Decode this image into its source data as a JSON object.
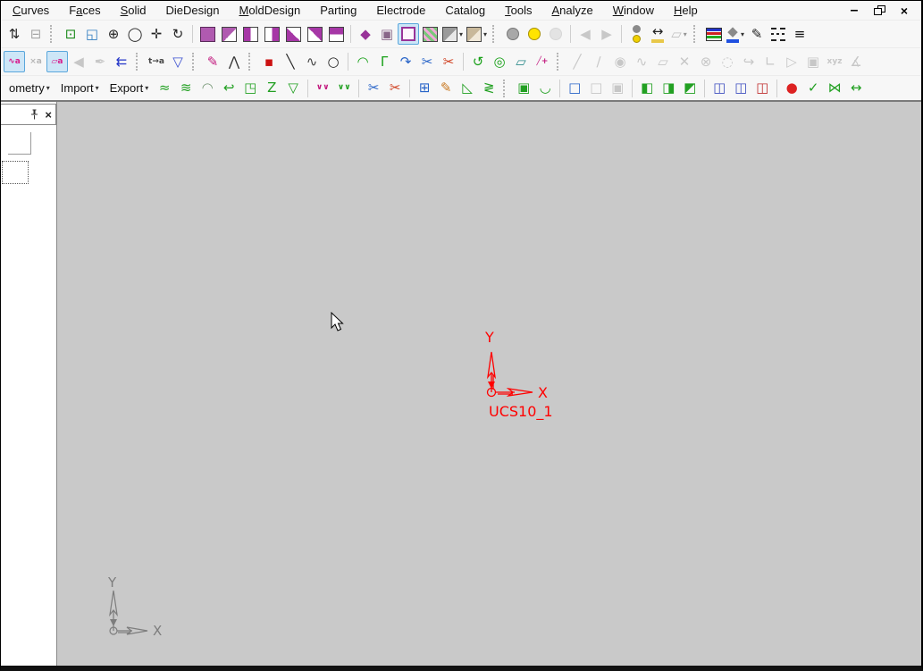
{
  "window_controls": {
    "minimize_glyph": "–",
    "close_glyph": "×"
  },
  "menubar": {
    "items": [
      {
        "label": "Curves",
        "u": 0
      },
      {
        "label": "Faces",
        "u": 1
      },
      {
        "label": "Solid",
        "u": 0
      },
      {
        "label": "DieDesign",
        "u": -1
      },
      {
        "label": "MoldDesign",
        "u": 0
      },
      {
        "label": "Parting",
        "u": -1
      },
      {
        "label": "Electrode",
        "u": -1
      },
      {
        "label": "Catalog",
        "u": -1
      },
      {
        "label": "Tools",
        "u": 0
      },
      {
        "label": "Analyze",
        "u": 0
      },
      {
        "label": "Window",
        "u": 0
      },
      {
        "label": "Help",
        "u": 0
      }
    ]
  },
  "toolbars": {
    "row2": [
      {
        "n": "rebuild-icon",
        "g": "⇅",
        "c": "#222222"
      },
      {
        "n": "delete-history-icon",
        "g": "⊟",
        "c": "#555555",
        "dis": 1
      },
      {
        "t": "grip"
      },
      {
        "n": "zoom-fit-icon",
        "g": "⊡",
        "c": "#1a8a1a"
      },
      {
        "n": "zoom-window-icon",
        "g": "◱",
        "c": "#2e7bbf"
      },
      {
        "n": "zoom-in-out-icon",
        "g": "⊕",
        "c": "#222222"
      },
      {
        "n": "magnifier-icon",
        "g": "◯",
        "c": "#222222"
      },
      {
        "n": "pan-icon",
        "g": "✛",
        "c": "#222222"
      },
      {
        "n": "rotate-view-icon",
        "g": "↻",
        "c": "#222222"
      },
      {
        "t": "sep"
      },
      {
        "n": "shaded-view-icon",
        "shape": "cube cube-solid"
      },
      {
        "n": "isometric-view-icon",
        "shape": "cube cube-iso"
      },
      {
        "n": "front-view-icon",
        "shape": "cube cube-front"
      },
      {
        "n": "back-view-icon",
        "shape": "cube cube-back"
      },
      {
        "n": "left-view-icon",
        "shape": "cube cube-left"
      },
      {
        "n": "right-view-icon",
        "shape": "cube cube-right"
      },
      {
        "n": "top-view-icon",
        "shape": "cube cube-top"
      },
      {
        "t": "sep"
      },
      {
        "n": "normal-to-icon",
        "g": "◆",
        "c": "#993399"
      },
      {
        "n": "named-view-icon",
        "g": "▣",
        "c": "#886688"
      },
      {
        "n": "wireframe-view-icon",
        "shape": "cube cube-wire",
        "sel": 1
      },
      {
        "n": "textured-view-icon",
        "shape": "cube cube-tex"
      },
      {
        "n": "display-style-dropdown",
        "shape": "cube cube-gray",
        "dd": 1
      },
      {
        "n": "view-options-dropdown",
        "shape": "cube cube-gray2",
        "dd": 1
      },
      {
        "t": "grip"
      },
      {
        "n": "light-off-icon",
        "shape": "bulb"
      },
      {
        "n": "light-on-icon",
        "shape": "bulb on"
      },
      {
        "n": "pick-light-icon",
        "shape": "bulb dim",
        "dis": 1
      },
      {
        "t": "sep"
      },
      {
        "n": "previous-view-icon",
        "g": "◀",
        "c": "#9a9a9a",
        "dis": 1
      },
      {
        "n": "next-view-icon",
        "g": "▶",
        "c": "#9a9a9a",
        "dis": 1
      },
      {
        "t": "sep"
      },
      {
        "n": "swap-display-icon",
        "shape": "dotswap"
      },
      {
        "n": "measure-icon",
        "g": "↔",
        "c": "#222222",
        "ub": "#e8c84a"
      },
      {
        "n": "dimension-dropdown",
        "g": "▱",
        "c": "#888888",
        "dis": 1,
        "dd": 1
      },
      {
        "t": "grip"
      },
      {
        "n": "layer-manager-icon",
        "shape": "layers"
      },
      {
        "n": "fill-color-dropdown",
        "g": "◆",
        "c": "#8a8a8a",
        "ub": "#2050e0",
        "dd": 1
      },
      {
        "n": "pen-color-icon",
        "g": "✎",
        "c": "#222222"
      },
      {
        "n": "line-style-icon",
        "shape": "dashes"
      },
      {
        "n": "line-weight-icon",
        "g": "≡",
        "c": "#111111"
      }
    ],
    "row3": [
      {
        "n": "curve-names-toggle",
        "g": "∿a",
        "c": "#d81b8c",
        "sel": 1,
        "sm": 1
      },
      {
        "n": "hide-names-icon",
        "g": "×a",
        "c": "#777777",
        "dis": 1,
        "sm": 1
      },
      {
        "n": "face-names-toggle",
        "g": "▱a",
        "c": "#d81b8c",
        "sel": 1,
        "sm": 1
      },
      {
        "n": "apply-color-icon",
        "g": "◀",
        "c": "#999999",
        "dis": 1
      },
      {
        "n": "signature-icon",
        "g": "✒",
        "c": "#999999",
        "dis": 1
      },
      {
        "n": "swap-list-icon",
        "g": "⇇",
        "c": "#2436c8"
      },
      {
        "t": "grip"
      },
      {
        "n": "rename-icon",
        "g": "t→a",
        "c": "#444444",
        "sm": 1
      },
      {
        "n": "selection-filter-icon",
        "g": "▽",
        "c": "#3a4fd0"
      },
      {
        "t": "grip"
      },
      {
        "n": "edit-sketch-icon",
        "g": "✎",
        "c": "#c2187e"
      },
      {
        "n": "lasso-select-icon",
        "g": "⋀",
        "c": "#333333"
      },
      {
        "t": "grip"
      },
      {
        "n": "point-icon",
        "g": "▪",
        "c": "#cc1111"
      },
      {
        "n": "line-icon",
        "g": "╲",
        "c": "#222222"
      },
      {
        "n": "spline-icon",
        "g": "∿",
        "c": "#444444"
      },
      {
        "n": "circle-icon",
        "g": "○",
        "c": "#222222"
      },
      {
        "t": "sep"
      },
      {
        "n": "fillet-curve-icon",
        "g": "◠",
        "c": "#18a018"
      },
      {
        "n": "corner-curve-icon",
        "g": "Γ",
        "c": "#18a018"
      },
      {
        "n": "extend-curve-icon",
        "g": "↷",
        "c": "#2864c8"
      },
      {
        "n": "trim-curve-icon",
        "g": "✂",
        "c": "#2864c8"
      },
      {
        "n": "split-curve-icon",
        "g": "✂",
        "c": "#d04020"
      },
      {
        "t": "sep"
      },
      {
        "n": "project-curve-icon",
        "g": "↺",
        "c": "#18a018"
      },
      {
        "n": "silhouette-curve-icon",
        "g": "◎",
        "c": "#18a018"
      },
      {
        "n": "flatten-curve-icon",
        "g": "▱",
        "c": "#2e8b8b"
      },
      {
        "n": "offset-curve-icon",
        "g": "╱+",
        "c": "#c2187e",
        "sm": 1
      },
      {
        "t": "grip"
      },
      {
        "n": "sketch-line-icon",
        "g": "╱",
        "c": "#999999",
        "dis": 1
      },
      {
        "n": "sketch-segment-icon",
        "g": "∕",
        "c": "#999999",
        "dis": 1
      },
      {
        "n": "sketch-circle-icon",
        "g": "◉",
        "c": "#999999",
        "dis": 1
      },
      {
        "n": "sketch-curve-icon",
        "g": "∿",
        "c": "#999999",
        "dis": 1
      },
      {
        "n": "sketch-plane-icon",
        "g": "▱",
        "c": "#999999",
        "dis": 1
      },
      {
        "n": "delete-entity-icon",
        "g": "✕",
        "c": "#999999",
        "dis": 1
      },
      {
        "n": "erase-entity-icon",
        "g": "⊗",
        "c": "#999999",
        "dis": 1
      },
      {
        "n": "select-chain-icon",
        "g": "◌",
        "c": "#999999",
        "dis": 1
      },
      {
        "n": "probe-point-icon",
        "g": "↪",
        "c": "#999999",
        "dis": 1
      },
      {
        "n": "axis-system-icon",
        "g": "∟",
        "c": "#999999",
        "dis": 1
      },
      {
        "n": "pointer-mode-icon",
        "g": "▷",
        "c": "#999999",
        "dis": 1
      },
      {
        "n": "grid-point-icon",
        "g": "▣",
        "c": "#999999",
        "dis": 1
      },
      {
        "n": "xyz-point-icon",
        "g": "xyz",
        "c": "#999999",
        "dis": 1,
        "sm": 1
      },
      {
        "n": "angle-point-icon",
        "g": "∡",
        "c": "#999999",
        "dis": 1
      }
    ],
    "row4": [
      {
        "n": "geometry-menu-button",
        "label": "ometry",
        "dd": 1
      },
      {
        "n": "import-menu-button",
        "label": "Import",
        "dd": 1
      },
      {
        "n": "export-menu-button",
        "label": "Export",
        "dd": 1
      },
      {
        "n": "surface-loft-icon",
        "g": "≈",
        "c": "#22a022"
      },
      {
        "n": "surface-sweep-icon",
        "g": "≋",
        "c": "#22a022"
      },
      {
        "n": "surface-dome-icon",
        "g": "◠",
        "c": "#7a9a7a"
      },
      {
        "n": "surface-flip-icon",
        "g": "↩",
        "c": "#22a022"
      },
      {
        "n": "surface-fold-icon",
        "g": "◳",
        "c": "#22a022"
      },
      {
        "n": "midplane-icon",
        "g": "Z",
        "c": "#22a022"
      },
      {
        "n": "surface-funnel-icon",
        "g": "▽",
        "c": "#22a022"
      },
      {
        "t": "sep"
      },
      {
        "n": "knit-surface-icon",
        "g": "∨∨",
        "c": "#c2187e",
        "sm": 1
      },
      {
        "n": "unknit-surface-icon",
        "g": "∨∨",
        "c": "#22a022",
        "sm": 1
      },
      {
        "t": "sep"
      },
      {
        "n": "trim-surface-icon",
        "g": "✂",
        "c": "#2864c8"
      },
      {
        "n": "untrim-surface-icon",
        "g": "✂",
        "c": "#d04020"
      },
      {
        "t": "sep"
      },
      {
        "n": "move-face-icon",
        "g": "⊞",
        "c": "#2864c8"
      },
      {
        "n": "edit-face-icon",
        "g": "✎",
        "c": "#c87820"
      },
      {
        "n": "flatten-surface-icon",
        "g": "◺",
        "c": "#22a022"
      },
      {
        "n": "replace-face-icon",
        "g": "≷",
        "c": "#22a022"
      },
      {
        "t": "grip"
      },
      {
        "n": "new-block-icon",
        "g": "▣",
        "c": "#22a022"
      },
      {
        "n": "new-cavity-icon",
        "g": "◡",
        "c": "#22a022"
      },
      {
        "t": "sep"
      },
      {
        "n": "open-box-icon",
        "g": "□",
        "c": "#2864c8"
      },
      {
        "n": "box-tool-icon",
        "g": "□",
        "c": "#999999",
        "dis": 1
      },
      {
        "n": "frame-box-icon",
        "g": "▣",
        "c": "#999999",
        "dis": 1
      },
      {
        "t": "sep"
      },
      {
        "n": "corner-solid-icon",
        "g": "◧",
        "c": "#22a022"
      },
      {
        "n": "wedge-solid-icon",
        "g": "◨",
        "c": "#22a022"
      },
      {
        "n": "notch-solid-icon",
        "g": "◩",
        "c": "#22a022"
      },
      {
        "t": "sep"
      },
      {
        "n": "insert-block-a-icon",
        "g": "◫",
        "c": "#4050c0"
      },
      {
        "n": "insert-block-b-icon",
        "g": "◫",
        "c": "#4050c0"
      },
      {
        "n": "insert-block-c-icon",
        "g": "◫",
        "c": "#c03030"
      },
      {
        "t": "sep"
      },
      {
        "n": "delete-body-icon",
        "g": "●",
        "c": "#dd2222"
      },
      {
        "n": "accept-body-icon",
        "g": "✓",
        "c": "#22a022"
      },
      {
        "n": "edit-parting-icon",
        "g": "⋈",
        "c": "#22a022"
      },
      {
        "n": "stretch-body-icon",
        "g": "↔",
        "c": "#22a022"
      }
    ]
  },
  "panel": {
    "close_glyph": "×"
  },
  "canvas": {
    "ucs": {
      "name_label": "UCS10_1",
      "x_label": "X",
      "y_label": "Y",
      "color": "#ff0000"
    },
    "triad": {
      "x_label": "X",
      "y_label": "Y",
      "color": "#7d7d7d"
    }
  },
  "colors": {
    "canvas_bg": "#c9c9c9",
    "toolbar_bg": "#f7f7f7",
    "selection_bg": "#cde6f7",
    "selection_border": "#5aa7dc",
    "accent_purple": "#993399",
    "ucs_red": "#ff0000",
    "triad_gray": "#7d7d7d"
  }
}
